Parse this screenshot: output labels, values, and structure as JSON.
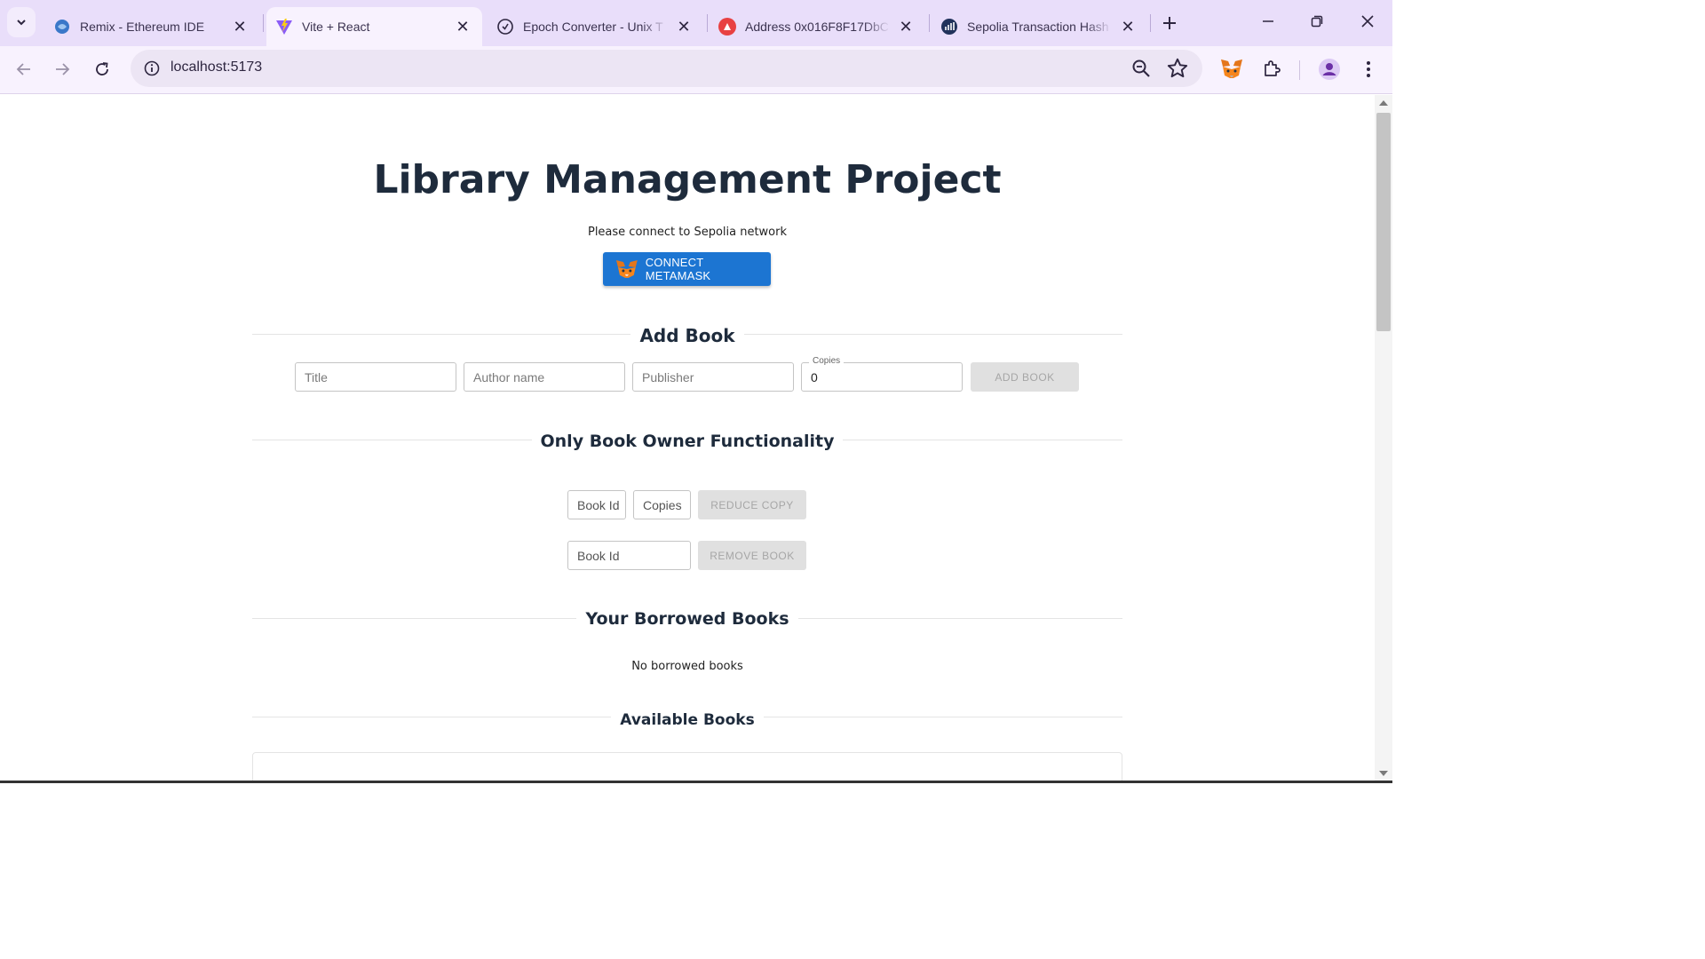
{
  "browser": {
    "tabs": [
      {
        "label": "Remix - Ethereum IDE",
        "icon": "remix-icon",
        "active": false
      },
      {
        "label": "Vite + React",
        "icon": "vite-icon",
        "active": true
      },
      {
        "label": "Epoch Converter - Unix T",
        "icon": "clock-icon",
        "active": false
      },
      {
        "label": "Address 0x016F8F17DbC",
        "icon": "avalanche-icon",
        "active": false
      },
      {
        "label": "Sepolia Transaction Hash",
        "icon": "etherscan-icon",
        "active": false
      }
    ],
    "url": "localhost:5173"
  },
  "page": {
    "title": "Library Management Project",
    "network_notice": "Please connect to Sepolia network",
    "connect_button": "CONNECT METAMASK",
    "add_book": {
      "heading": "Add Book",
      "title_placeholder": "Title",
      "author_placeholder": "Author name",
      "publisher_placeholder": "Publisher",
      "copies_label": "Copies",
      "copies_value": "0",
      "button": "ADD BOOK"
    },
    "owner": {
      "heading": "Only Book Owner Functionality",
      "reduce_bookid_placeholder": "Book Id",
      "reduce_copies_placeholder": "Copies",
      "reduce_button": "REDUCE COPY",
      "remove_bookid_placeholder": "Book Id",
      "remove_button": "REMOVE BOOK"
    },
    "borrowed": {
      "heading": "Your Borrowed Books",
      "empty_text": "No borrowed books"
    },
    "available": {
      "heading": "Available Books"
    }
  },
  "colors": {
    "tabbar_bg": "#e9defa",
    "toolbar_bg": "#f8f2fe",
    "primary_button": "#1c75d2",
    "heading_text": "#1e2b3c"
  }
}
